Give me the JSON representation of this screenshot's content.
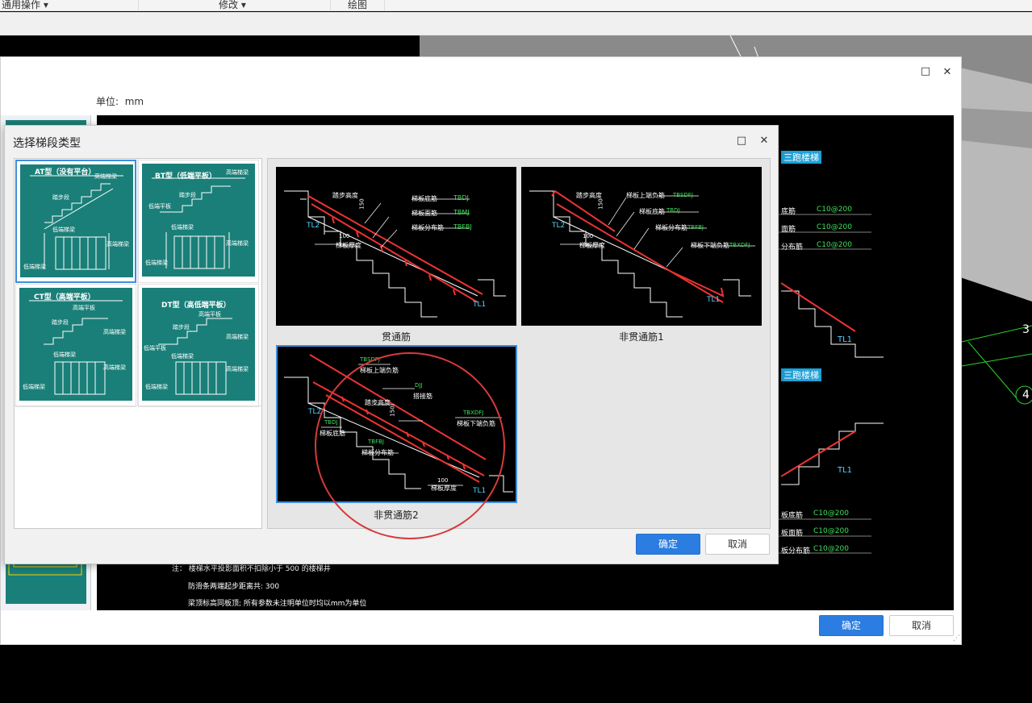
{
  "toolbar": {
    "items": [
      {
        "label": "通用操作 ▾"
      },
      {
        "label": "修改 ▾"
      },
      {
        "label": "绘图"
      }
    ]
  },
  "outer_dialog": {
    "unit_label": "单位:",
    "unit_value": "mm",
    "maximize_icon": "□",
    "close_icon": "✕",
    "ok_label": "确定",
    "cancel_label": "取消",
    "cad_texts": {
      "band_label_1": "三跑楼梯",
      "band_label_2": "三跑楼梯",
      "rebar_rows_top": [
        {
          "name": "底筋",
          "value": "C10@200"
        },
        {
          "name": "面筋",
          "value": "C10@200"
        },
        {
          "name": "分布筋",
          "value": "C10@200"
        }
      ],
      "rebar_rows_bottom": [
        {
          "name": "板底筋",
          "value": "C10@200"
        },
        {
          "name": "板面筋",
          "value": "C10@200"
        },
        {
          "name": "板分布筋",
          "value": "C10@200"
        }
      ],
      "tl1_a": "TL1",
      "tl1_b": "TL1",
      "note_1": "注：  楼梯水平投影面积不扣除小于 500 的楼梯井",
      "note_2": "防滑条两端起步距离共: 300",
      "note_3": "梁顶标高同板顶; 所有参数未注明单位时均以mm为单位",
      "label_3": "3",
      "label_4": "4"
    }
  },
  "inner_dialog": {
    "title": "选择梯段类型",
    "maximize_icon": "□",
    "close_icon": "✕",
    "ok_label": "确定",
    "cancel_label": "取消",
    "stair_types": [
      {
        "title": "AT型（没有平台）",
        "labels": [
          "高端梯梁",
          "踏步段",
          "低端梯梁",
          "高端梯梁",
          "低端梯梁"
        ]
      },
      {
        "title": "BT型（低端平板）",
        "labels": [
          "高端梯梁",
          "踏步段",
          "低端平板",
          "低端梯梁",
          "高端梯梁",
          "低端梯梁"
        ]
      },
      {
        "title": "CT型（高端平板）",
        "labels": [
          "高端平板",
          "高端梯梁",
          "踏步段",
          "低端梯梁",
          "高端梯梁",
          "低端梯梁"
        ]
      },
      {
        "title": "DT型（高低端平板）",
        "labels": [
          "高端平板",
          "高端梯梁",
          "踏步段",
          "低端平板",
          "低端梯梁",
          "高端梯梁",
          "低端梯梁"
        ]
      }
    ],
    "rebar_options": [
      {
        "caption": "贯通筋",
        "texts": {
          "step_height": "踏步高度",
          "h150": "150",
          "bottom": "梯板底筋",
          "bottom_code": "TBDJ",
          "top": "梯板面筋",
          "top_code": "TBMJ",
          "dist": "梯板分布筋",
          "dist_code": "TBFBJ",
          "hundred": "100",
          "thickness": "梯板厚度",
          "tl2": "TL2",
          "tl1": "TL1"
        }
      },
      {
        "caption": "非贯通筋1",
        "texts": {
          "step_height": "踏步高度",
          "h150": "150",
          "top_neg": "梯板上端负筋",
          "top_neg_code": "TBSDFJ",
          "bottom": "梯板底筋",
          "bottom_code": "TBDJ",
          "dist": "梯板分布筋",
          "dist_code": "TBFBJ",
          "low_neg": "梯板下端负筋",
          "low_neg_code": "TBXDFJ",
          "hundred": "100",
          "thickness": "梯板厚度",
          "tl2": "TL2",
          "tl1": "TL1"
        }
      },
      {
        "caption": "非贯通筋2",
        "texts": {
          "top_neg_code": "TBSDFJ",
          "top_neg": "梯板上端负筋",
          "djj_code": "DJJ",
          "djj": "搭接筋",
          "step_height": "踏步高度",
          "h150": "150",
          "low_neg_code": "TBXDFJ",
          "low_neg": "梯板下端负筋",
          "bottom_code": "TBDJ",
          "bottom": "梯板底筋",
          "dist_code": "TBFBJ",
          "dist": "梯板分布筋",
          "hundred": "100",
          "thickness": "梯板厚度",
          "tl2": "TL2",
          "tl1": "TL1"
        }
      }
    ]
  }
}
